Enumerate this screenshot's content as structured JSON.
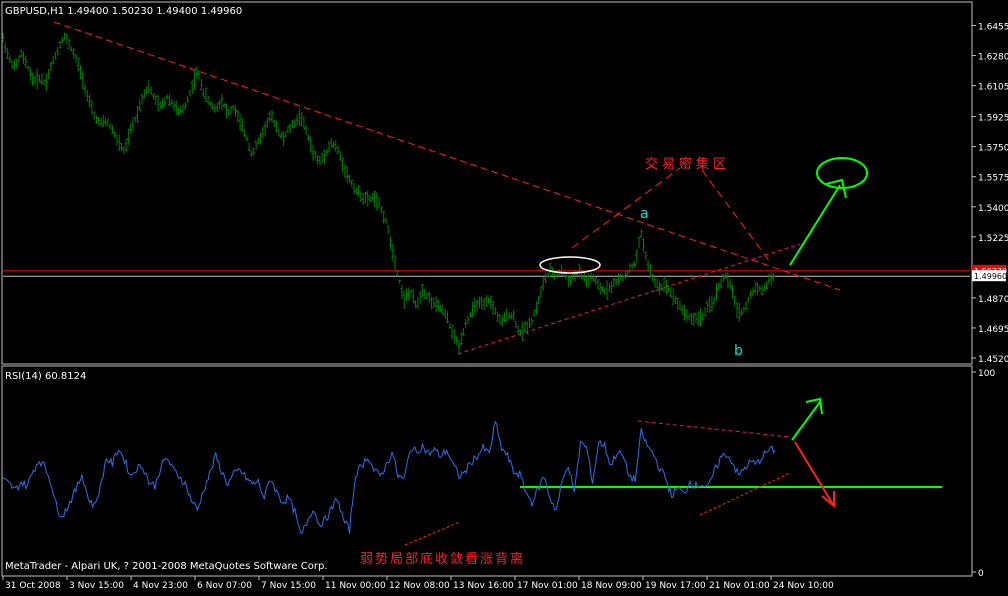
{
  "chart_data": [
    {
      "type": "ohlc",
      "title": "GBPUSD,H1  1.49400 1.50230 1.49400 1.49960",
      "symbol": "GBPUSD,H1",
      "last_bar": {
        "open": 1.494,
        "high": 1.5023,
        "low": 1.494,
        "close": 1.4996
      },
      "ylim": [
        1.452,
        1.6545
      ],
      "y_ticks": [
        "1.64550",
        "1.62800",
        "1.61050",
        "1.59250",
        "1.57500",
        "1.55750",
        "1.54000",
        "1.52250",
        "1.48700",
        "1.46950",
        "1.45200"
      ],
      "current_price_labels": [
        "1.50270",
        "1.49960"
      ],
      "current_price_levels": [
        1.5027,
        1.4996
      ],
      "price_path": [
        [
          0,
          1.638
        ],
        [
          4,
          1.626
        ],
        [
          8,
          1.621
        ],
        [
          12,
          1.629
        ],
        [
          16,
          1.622
        ],
        [
          20,
          1.613
        ],
        [
          24,
          1.615
        ],
        [
          28,
          1.612
        ],
        [
          32,
          1.623
        ],
        [
          36,
          1.631
        ],
        [
          40,
          1.64
        ],
        [
          44,
          1.634
        ],
        [
          48,
          1.626
        ],
        [
          52,
          1.616
        ],
        [
          56,
          1.603
        ],
        [
          60,
          1.593
        ],
        [
          64,
          1.588
        ],
        [
          68,
          1.59
        ],
        [
          72,
          1.585
        ],
        [
          76,
          1.577
        ],
        [
          80,
          1.572
        ],
        [
          84,
          1.585
        ],
        [
          88,
          1.593
        ],
        [
          92,
          1.605
        ],
        [
          96,
          1.61
        ],
        [
          100,
          1.602
        ],
        [
          104,
          1.598
        ],
        [
          108,
          1.604
        ],
        [
          112,
          1.6
        ],
        [
          116,
          1.594
        ],
        [
          120,
          1.599
        ],
        [
          124,
          1.609
        ],
        [
          128,
          1.619
        ],
        [
          132,
          1.607
        ],
        [
          136,
          1.6
        ],
        [
          140,
          1.597
        ],
        [
          144,
          1.602
        ],
        [
          148,
          1.594
        ],
        [
          152,
          1.598
        ],
        [
          156,
          1.589
        ],
        [
          160,
          1.581
        ],
        [
          164,
          1.57
        ],
        [
          168,
          1.578
        ],
        [
          172,
          1.585
        ],
        [
          176,
          1.593
        ],
        [
          180,
          1.587
        ],
        [
          184,
          1.579
        ],
        [
          188,
          1.585
        ],
        [
          192,
          1.589
        ],
        [
          196,
          1.593
        ],
        [
          200,
          1.583
        ],
        [
          204,
          1.572
        ],
        [
          208,
          1.566
        ],
        [
          212,
          1.571
        ],
        [
          216,
          1.577
        ],
        [
          220,
          1.574
        ],
        [
          224,
          1.564
        ],
        [
          228,
          1.556
        ],
        [
          232,
          1.55
        ],
        [
          236,
          1.546
        ],
        [
          240,
          1.544
        ],
        [
          244,
          1.546
        ],
        [
          248,
          1.54
        ],
        [
          252,
          1.532
        ],
        [
          256,
          1.516
        ],
        [
          260,
          1.5
        ],
        [
          264,
          1.486
        ],
        [
          268,
          1.491
        ],
        [
          272,
          1.482
        ],
        [
          276,
          1.492
        ],
        [
          280,
          1.487
        ],
        [
          284,
          1.483
        ],
        [
          288,
          1.481
        ],
        [
          292,
          1.476
        ],
        [
          296,
          1.466
        ],
        [
          300,
          1.459
        ],
        [
          304,
          1.471
        ],
        [
          308,
          1.478
        ],
        [
          312,
          1.484
        ],
        [
          316,
          1.482
        ],
        [
          320,
          1.486
        ],
        [
          324,
          1.479
        ],
        [
          328,
          1.472
        ],
        [
          332,
          1.478
        ],
        [
          336,
          1.476
        ],
        [
          340,
          1.466
        ],
        [
          344,
          1.47
        ],
        [
          348,
          1.474
        ],
        [
          352,
          1.484
        ],
        [
          356,
          1.497
        ],
        [
          360,
          1.502
        ],
        [
          364,
          1.5
        ],
        [
          368,
          1.503
        ],
        [
          372,
          1.497
        ],
        [
          376,
          1.5
        ],
        [
          380,
          1.502
        ],
        [
          384,
          1.496
        ],
        [
          388,
          1.499
        ],
        [
          392,
          1.493
        ],
        [
          396,
          1.491
        ],
        [
          400,
          1.494
        ],
        [
          404,
          1.497
        ],
        [
          408,
          1.499
        ],
        [
          412,
          1.503
        ],
        [
          416,
          1.507
        ],
        [
          420,
          1.525
        ],
        [
          424,
          1.507
        ],
        [
          428,
          1.497
        ],
        [
          432,
          1.493
        ],
        [
          436,
          1.495
        ],
        [
          440,
          1.49
        ],
        [
          444,
          1.484
        ],
        [
          448,
          1.479
        ],
        [
          452,
          1.475
        ],
        [
          456,
          1.475
        ],
        [
          460,
          1.476
        ],
        [
          464,
          1.481
        ],
        [
          468,
          1.486
        ],
        [
          472,
          1.496
        ],
        [
          476,
          1.5
        ],
        [
          480,
          1.49
        ],
        [
          484,
          1.478
        ],
        [
          488,
          1.48
        ],
        [
          492,
          1.489
        ],
        [
          496,
          1.494
        ],
        [
          500,
          1.491
        ],
        [
          504,
          1.497
        ],
        [
          508,
          1.5
        ]
      ]
    },
    {
      "type": "line",
      "title": "RSI(14) 60.8124",
      "ylim": [
        0,
        100
      ],
      "y_ticks": [
        "100",
        "0"
      ],
      "series": [
        {
          "values": [
            [
              0,
              46
            ],
            [
              4,
              44
            ],
            [
              8,
              41
            ],
            [
              12,
              45
            ],
            [
              16,
              43
            ],
            [
              20,
              51
            ],
            [
              24,
              56
            ],
            [
              28,
              52
            ],
            [
              32,
              44
            ],
            [
              36,
              30
            ],
            [
              40,
              29
            ],
            [
              44,
              35
            ],
            [
              48,
              41
            ],
            [
              52,
              49
            ],
            [
              56,
              37
            ],
            [
              60,
              33
            ],
            [
              64,
              42
            ],
            [
              68,
              57
            ],
            [
              72,
              54
            ],
            [
              76,
              62
            ],
            [
              80,
              56
            ],
            [
              84,
              48
            ],
            [
              88,
              52
            ],
            [
              92,
              53
            ],
            [
              96,
              45
            ],
            [
              100,
              43
            ],
            [
              104,
              53
            ],
            [
              108,
              57
            ],
            [
              112,
              51
            ],
            [
              116,
              48
            ],
            [
              120,
              44
            ],
            [
              124,
              36
            ],
            [
              128,
              31
            ],
            [
              132,
              41
            ],
            [
              136,
              49
            ],
            [
              140,
              58
            ],
            [
              144,
              50
            ],
            [
              148,
              44
            ],
            [
              152,
              49
            ],
            [
              156,
              51
            ],
            [
              160,
              47
            ],
            [
              164,
              44
            ],
            [
              168,
              45
            ],
            [
              172,
              37
            ],
            [
              176,
              47
            ],
            [
              180,
              40
            ],
            [
              184,
              35
            ],
            [
              188,
              37
            ],
            [
              192,
              30
            ],
            [
              196,
              18
            ],
            [
              200,
              25
            ],
            [
              204,
              32
            ],
            [
              208,
              24
            ],
            [
              212,
              26
            ],
            [
              216,
              31
            ],
            [
              220,
              37
            ],
            [
              224,
              26
            ],
            [
              228,
              21
            ],
            [
              232,
              49
            ],
            [
              236,
              53
            ],
            [
              240,
              58
            ],
            [
              244,
              51
            ],
            [
              248,
              48
            ],
            [
              252,
              53
            ],
            [
              256,
              60
            ],
            [
              260,
              48
            ],
            [
              264,
              46
            ],
            [
              268,
              62
            ],
            [
              272,
              60
            ],
            [
              276,
              63
            ],
            [
              280,
              59
            ],
            [
              284,
              61
            ],
            [
              288,
              58
            ],
            [
              292,
              61
            ],
            [
              296,
              54
            ],
            [
              300,
              48
            ],
            [
              304,
              50
            ],
            [
              308,
              55
            ],
            [
              312,
              58
            ],
            [
              316,
              62
            ],
            [
              320,
              59
            ],
            [
              324,
              75
            ],
            [
              328,
              62
            ],
            [
              332,
              58
            ],
            [
              336,
              50
            ],
            [
              340,
              49
            ],
            [
              344,
              40
            ],
            [
              348,
              35
            ],
            [
              352,
              41
            ],
            [
              356,
              48
            ],
            [
              360,
              37
            ],
            [
              364,
              31
            ],
            [
              368,
              45
            ],
            [
              372,
              54
            ],
            [
              376,
              39
            ],
            [
              380,
              65
            ],
            [
              384,
              62
            ],
            [
              388,
              45
            ],
            [
              392,
              65
            ],
            [
              396,
              63
            ],
            [
              400,
              53
            ],
            [
              404,
              60
            ],
            [
              408,
              58
            ],
            [
              412,
              48
            ],
            [
              416,
              46
            ],
            [
              420,
              70
            ],
            [
              424,
              63
            ],
            [
              428,
              59
            ],
            [
              432,
              52
            ],
            [
              436,
              47
            ],
            [
              440,
              38
            ],
            [
              444,
              42
            ],
            [
              448,
              39
            ],
            [
              452,
              45
            ],
            [
              456,
              43
            ],
            [
              460,
              44
            ],
            [
              464,
              42
            ],
            [
              468,
              50
            ],
            [
              472,
              57
            ],
            [
              476,
              59
            ],
            [
              480,
              55
            ],
            [
              484,
              48
            ],
            [
              488,
              52
            ],
            [
              492,
              55
            ],
            [
              496,
              54
            ],
            [
              500,
              58
            ],
            [
              504,
              61
            ],
            [
              508,
              61
            ]
          ]
        }
      ]
    }
  ],
  "x_axis": {
    "labels": [
      "31 Oct 2008",
      "3 Nov 15:00",
      "4 Nov 23:00",
      "6 Nov 07:00",
      "7 Nov 15:00",
      "11 Nov 00:00",
      "12 Nov 08:00",
      "13 Nov 16:00",
      "17 Nov 01:00",
      "18 Nov 09:00",
      "19 Nov 17:00",
      "21 Nov 01:00",
      "24 Nov 10:00"
    ]
  },
  "annotations": {
    "zone_label": "交易密集区",
    "point_a": "a",
    "point_b": "b",
    "divergence_label": "弱势局部底收敛看涨背离",
    "copyright": "MetaTrader - Alpari UK, ? 2001-2008 MetaQuotes Software Corp."
  },
  "colors": {
    "background": "#000000",
    "bars": "#008000",
    "rsi_line": "#2f6fe8",
    "axis": "#c0c0c0",
    "trendline": "#ff2020",
    "trendline_dashed": "#e0186a",
    "support": "#00ff00",
    "price_line": "#ff0000",
    "label_cyan": "#00e0e0",
    "text": "#ffffff"
  }
}
